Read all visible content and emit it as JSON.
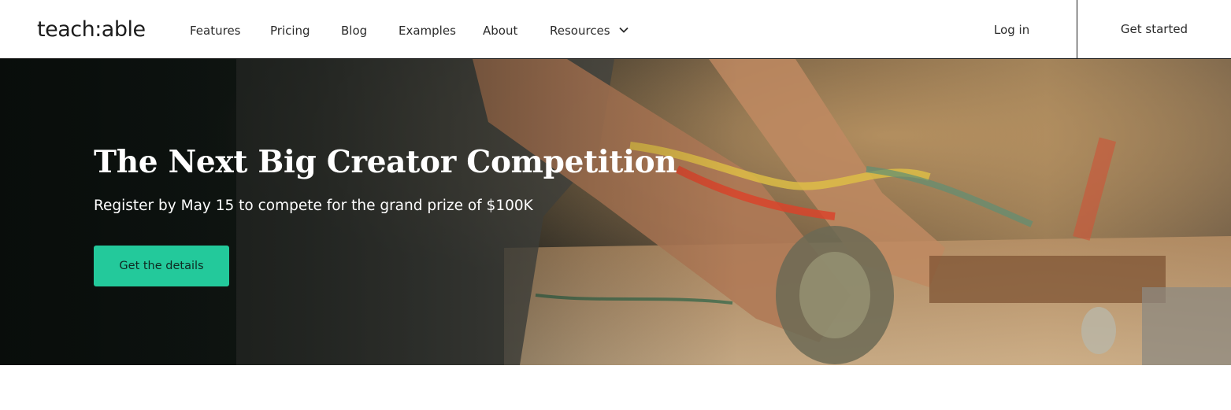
{
  "header": {
    "logo": "teach:able",
    "nav": {
      "features": "Features",
      "pricing": "Pricing",
      "blog": "Blog",
      "examples": "Examples",
      "about": "About",
      "resources": "Resources"
    },
    "login": "Log in",
    "get_started": "Get started"
  },
  "hero": {
    "title": "The Next Big Creator Competition",
    "subtitle": "Register by May 15 to compete for the grand prize of $100K",
    "cta": "Get the details",
    "cta_color": "#23c99b"
  },
  "icons": {
    "resources_dropdown": "chevron-down-icon"
  }
}
